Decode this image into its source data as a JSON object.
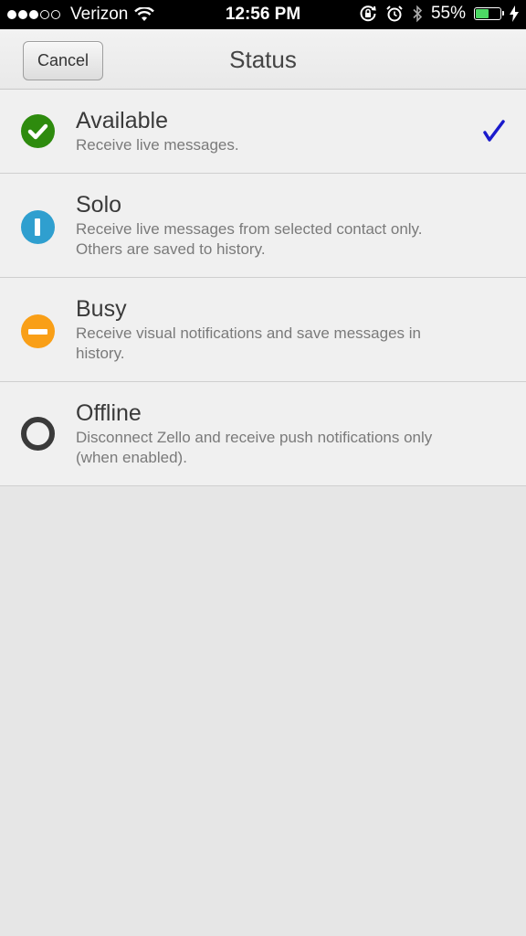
{
  "status_bar": {
    "carrier": "Verizon",
    "time": "12:56 PM",
    "battery_percent": "55%",
    "battery_level": 0.55,
    "signal_full": 3,
    "signal_total": 5
  },
  "nav": {
    "cancel_label": "Cancel",
    "title": "Status"
  },
  "statuses": [
    {
      "title": "Available",
      "description": "Receive live messages.",
      "icon": "check-circle-icon",
      "color": "#2e8b0e",
      "selected": true
    },
    {
      "title": "Solo",
      "description": "Receive live messages from selected contact only.\nOthers are saved to history.",
      "icon": "solo-icon",
      "color": "#2f9fcf",
      "selected": false
    },
    {
      "title": "Busy",
      "description": "Receive visual notifications and save messages in\nhistory.",
      "icon": "busy-icon",
      "color": "#f99f17",
      "selected": false
    },
    {
      "title": "Offline",
      "description": "Disconnect Zello and receive push notifications only\n(when enabled).",
      "icon": "offline-icon",
      "color": "#3a3a3a",
      "selected": false
    }
  ],
  "colors": {
    "checkmark": "#1a1acc",
    "battery_fill": "#4cd964"
  }
}
